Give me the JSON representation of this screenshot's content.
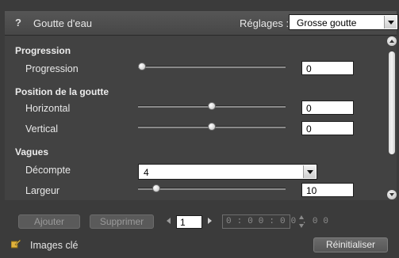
{
  "header": {
    "help_icon": "?",
    "title": "Goutte d'eau",
    "preset_label": "Réglages :",
    "preset_value": "Grosse goutte"
  },
  "sections": {
    "progression": {
      "heading": "Progression",
      "label": "Progression",
      "value": "0",
      "slider_fraction": 0.0
    },
    "position": {
      "heading": "Position de la goutte",
      "horizontal_label": "Horizontal",
      "horizontal_value": "0",
      "horizontal_fraction": 0.5,
      "vertical_label": "Vertical",
      "vertical_value": "0",
      "vertical_fraction": 0.5
    },
    "waves": {
      "heading": "Vagues",
      "countdown_label": "Décompte",
      "countdown_value": "4",
      "width_label": "Largeur",
      "width_value": "10",
      "width_fraction": 0.1
    }
  },
  "keyframes": {
    "add_label": "Ajouter",
    "remove_label": "Supprimer",
    "frame_index": "1",
    "timecode": "0 : 0 0 : 0 0 . 0 0",
    "keyframes_label": "Images clé",
    "reset_label": "Réinitialiser"
  },
  "icons": {
    "help": "help-icon",
    "dropdown": "chevron-down-icon",
    "scroll_up": "arrow-up-icon",
    "scroll_down": "arrow-down-icon",
    "prev": "triangle-left-icon",
    "next": "triangle-right-icon",
    "spinner": "spinner-icon",
    "keyframe": "pencil-key-icon"
  },
  "colors": {
    "background": "#3b3b3b",
    "panel": "#424242",
    "titlebar": "#4e4e4e"
  }
}
